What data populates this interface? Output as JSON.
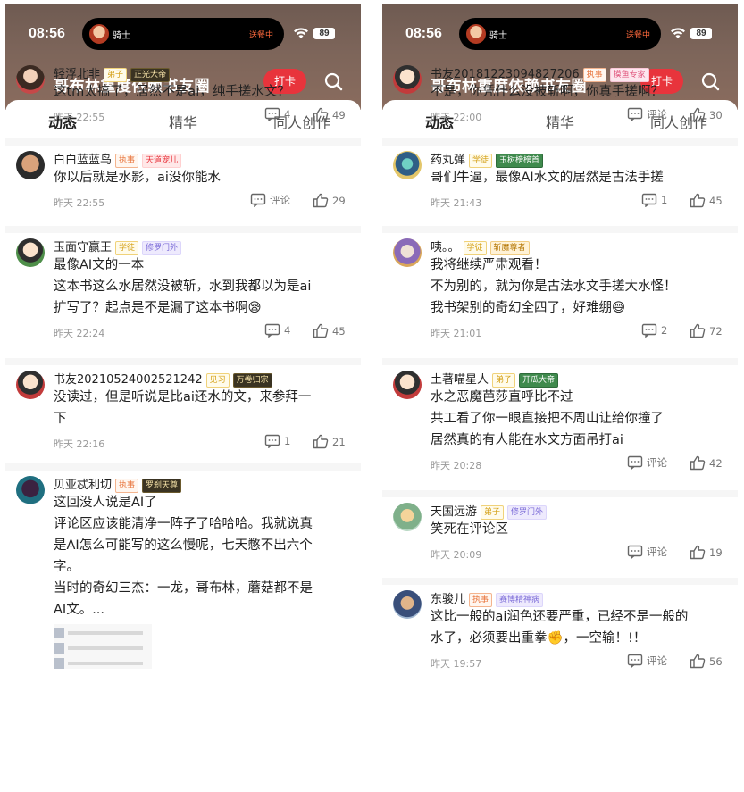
{
  "status": {
    "time": "08:56",
    "island_name": "骑士",
    "island_status": "送餐中",
    "battery": "89"
  },
  "nav": {
    "title": "哥布林重度依赖书友圈",
    "checkin": "打卡"
  },
  "tabs": [
    "动态",
    "精华",
    "同人创作"
  ],
  "comment_label": "评论",
  "left_posts": [
    {
      "user": "轻浮北非",
      "badges": [
        {
          "text": "弟子",
          "style": "b-yellow"
        },
        {
          "text": "正光大帝",
          "style": "b-dark"
        }
      ],
      "lines": [
        "这tm太搞了，居然不是ai，纯手搓水文？"
      ],
      "time": "昨天 22:55",
      "comments": "4",
      "likes": "49"
    },
    {
      "user": "白白蓝蓝鸟",
      "badges": [
        {
          "text": "执事",
          "style": "b-orange"
        },
        {
          "text": "天道宠儿",
          "style": "b-red"
        }
      ],
      "lines": [
        "你以后就是水影，ai没你能水"
      ],
      "time": "昨天 22:55",
      "comments": "评论",
      "likes": "29"
    },
    {
      "user": "玉面守赢王",
      "badges": [
        {
          "text": "学徒",
          "style": "b-yellow"
        },
        {
          "text": "修罗门外",
          "style": "b-purple"
        }
      ],
      "lines": [
        "最像AI文的一本",
        "这本书这么水居然没被斩，水到我都以为是ai",
        "扩写了？起点是不是漏了这本书啊😪"
      ],
      "time": "昨天 22:24",
      "comments": "4",
      "likes": "45"
    },
    {
      "user": "书友20210524002521242",
      "badges": [
        {
          "text": "见习",
          "style": "b-yellow"
        },
        {
          "text": "万卷归宗",
          "style": "b-dark"
        }
      ],
      "lines": [
        "没读过，但是听说是比ai还水的文，来参拜一",
        "下"
      ],
      "time": "昨天 22:16",
      "comments": "1",
      "likes": "21"
    },
    {
      "user": "贝亚忒利切",
      "badges": [
        {
          "text": "执事",
          "style": "b-orange"
        },
        {
          "text": "罗刹天尊",
          "style": "b-dark"
        }
      ],
      "lines": [
        "这回没人说是AI了",
        "评论区应该能清净一阵子了哈哈哈。我就说真",
        "是AI怎么可能写的这么慢呢，七天憋不出六个",
        "字。",
        "当时的奇幻三杰：一龙，哥布林，蘑菇都不是",
        "AI文。..."
      ],
      "time": "",
      "comments": "",
      "likes": ""
    }
  ],
  "right_posts": [
    {
      "user": "书友20181223094827206",
      "badges": [
        {
          "text": "执事",
          "style": "b-orange"
        },
        {
          "text": "摸鱼专家",
          "style": "b-pink"
        }
      ],
      "lines": [
        "不是，你凭什么没被斩啊，你真手搓啊？"
      ],
      "time": "昨天 22:00",
      "comments": "评论",
      "likes": "30"
    },
    {
      "user": "药丸弹",
      "badges": [
        {
          "text": "学徒",
          "style": "b-yellow"
        },
        {
          "text": "玉树榜榜首",
          "style": "b-green"
        }
      ],
      "lines": [
        "哥们牛逼，最像AI水文的居然是古法手搓"
      ],
      "time": "昨天 21:43",
      "comments": "1",
      "likes": "45"
    },
    {
      "user": "咦。。",
      "badges": [
        {
          "text": "学徒",
          "style": "b-yellow"
        },
        {
          "text": "斩魔尊者",
          "style": "b-gold"
        }
      ],
      "lines": [
        "我将继续严肃观看！",
        "不为别的，就为你是古法水文手搓大水怪！",
        "我书架别的奇幻全四了，好难绷😅"
      ],
      "time": "昨天 21:01",
      "comments": "2",
      "likes": "72"
    },
    {
      "user": "土著喵星人",
      "badges": [
        {
          "text": "弟子",
          "style": "b-yellow"
        },
        {
          "text": "开瓜大帝",
          "style": "b-green"
        }
      ],
      "lines": [
        "水之恶魔芭莎直呼比不过",
        "共工看了你一眼直接把不周山让给你撞了",
        "居然真的有人能在水文方面吊打ai"
      ],
      "time": "昨天 20:28",
      "comments": "评论",
      "likes": "42"
    },
    {
      "user": "天国远游",
      "badges": [
        {
          "text": "弟子",
          "style": "b-yellow"
        },
        {
          "text": "修罗门外",
          "style": "b-purple"
        }
      ],
      "lines": [
        "笑死在评论区"
      ],
      "time": "昨天 20:09",
      "comments": "评论",
      "likes": "19"
    },
    {
      "user": "东骏儿",
      "badges": [
        {
          "text": "执事",
          "style": "b-orange"
        },
        {
          "text": "赛博精神病",
          "style": "b-purple"
        }
      ],
      "lines": [
        "这比一般的ai润色还要严重，已经不是一般的",
        "水了，必须要出重拳✊，一空输！!！"
      ],
      "time": "昨天 19:57",
      "comments": "评论",
      "likes": "56"
    }
  ],
  "colors": {
    "accent": "#e8343c",
    "header_top": "#6f5b52"
  }
}
